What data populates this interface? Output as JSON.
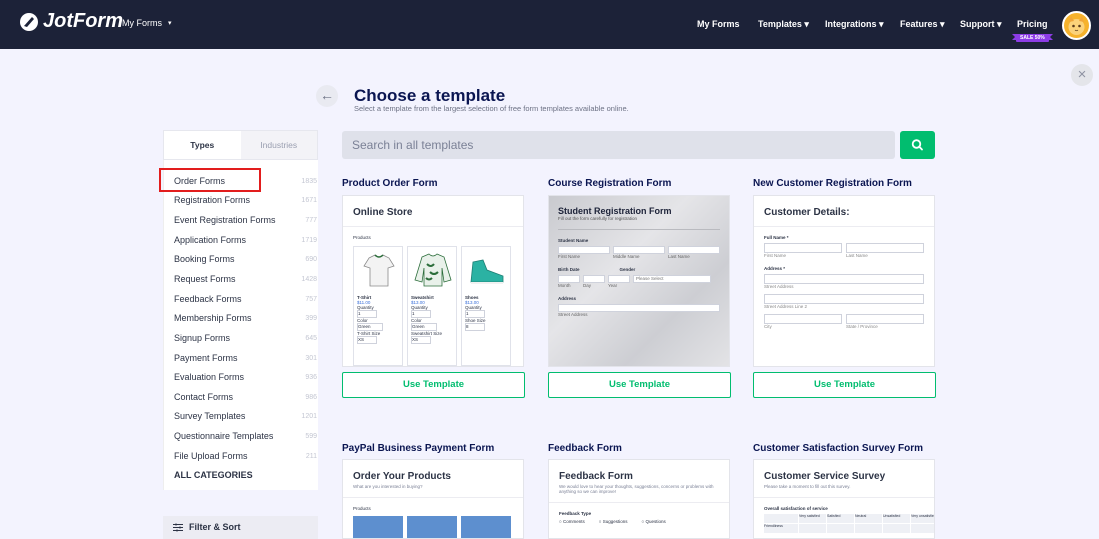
{
  "header": {
    "brand": "JotForm",
    "myforms_dropdown": "My Forms",
    "nav": [
      {
        "label": "My Forms"
      },
      {
        "label": "Templates ▾"
      },
      {
        "label": "Integrations ▾"
      },
      {
        "label": "Features ▾"
      },
      {
        "label": "Support ▾"
      },
      {
        "label": "Pricing"
      }
    ],
    "sale_badge": "SALE 50%"
  },
  "page": {
    "title": "Choose a template",
    "subtitle": "Select a template from the largest selection of free form templates available online."
  },
  "tabs": [
    {
      "label": "Types"
    },
    {
      "label": "Industries"
    }
  ],
  "categories": [
    {
      "label": "Order Forms",
      "count": "1835"
    },
    {
      "label": "Registration Forms",
      "count": "1671"
    },
    {
      "label": "Event Registration Forms",
      "count": "777"
    },
    {
      "label": "Application Forms",
      "count": "1719"
    },
    {
      "label": "Booking Forms",
      "count": "690"
    },
    {
      "label": "Request Forms",
      "count": "1428"
    },
    {
      "label": "Feedback Forms",
      "count": "757"
    },
    {
      "label": "Membership Forms",
      "count": "399"
    },
    {
      "label": "Signup Forms",
      "count": "645"
    },
    {
      "label": "Payment Forms",
      "count": "301"
    },
    {
      "label": "Evaluation Forms",
      "count": "936"
    },
    {
      "label": "Contact Forms",
      "count": "986"
    },
    {
      "label": "Survey Templates",
      "count": "1201"
    },
    {
      "label": "Questionnaire Templates",
      "count": "599"
    },
    {
      "label": "File Upload Forms",
      "count": "211"
    }
  ],
  "all_categories": "ALL CATEGORIES",
  "filter_sort": "Filter & Sort",
  "search": {
    "placeholder": "Search in all templates"
  },
  "use_template_label": "Use Template",
  "templates": [
    {
      "title": "Product Order Form",
      "preview": {
        "heading": "Online Store",
        "section": "Products",
        "products": [
          {
            "name": "T-Shirt",
            "price": "$11.00",
            "qty_label": "Quantity",
            "qty": "1",
            "color_label": "Color",
            "color": "Green",
            "size_label": "T-Shirt Size",
            "size": "XS"
          },
          {
            "name": "Sweatshirt",
            "price": "$13.00",
            "qty_label": "Quantity",
            "qty": "1",
            "color_label": "Color",
            "color": "Green",
            "size_label": "Sweatshirt Size",
            "size": "XS"
          },
          {
            "name": "Shoes",
            "price": "$13.00",
            "qty_label": "Quantity",
            "qty": "1",
            "size_label": "Shoe Size",
            "size": "8"
          }
        ]
      }
    },
    {
      "title": "Course Registration Form",
      "preview": {
        "heading": "Student Registration Form",
        "sub": "Fill out the form carefully for registration",
        "name_label": "Student Name",
        "name_parts": [
          "First Name",
          "Middle Name",
          "Last Name"
        ],
        "birth_label": "Birth Date",
        "birth_parts": [
          "Month",
          "Day",
          "Year"
        ],
        "gender_label": "Gender",
        "gender_placeholder": "Please Select",
        "address_label": "Address",
        "street_label": "Street Address"
      }
    },
    {
      "title": "New Customer Registration Form",
      "preview": {
        "heading": "Customer Details:",
        "fullname_label": "Full Name *",
        "name_parts": [
          "First Name",
          "Last Name"
        ],
        "address_label": "Address *",
        "street1": "Street Address",
        "street2": "Street Address Line 2",
        "city": "City",
        "state": "State / Province"
      }
    },
    {
      "title": "PayPal Business Payment Form",
      "preview": {
        "heading": "Order Your Products",
        "sub": "What are you interested in buying?",
        "section": "Products"
      }
    },
    {
      "title": "Feedback Form",
      "preview": {
        "heading": "Feedback Form",
        "sub": "We would love to hear your thoughts, suggestions, concerns or problems with anything so we can improve!",
        "type_label": "Feedback Type",
        "options": [
          "Comments",
          "Suggestions",
          "Questions"
        ]
      }
    },
    {
      "title": "Customer Satisfaction Survey Form",
      "preview": {
        "heading": "Customer Service Survey",
        "sub": "Please take a moment to fill out this survey.",
        "matrix_label": "Overall satisfaction of service",
        "columns": [
          "Very satisfied",
          "Satisfied",
          "Neutral",
          "Unsatisfied",
          "Very unsatisfied"
        ],
        "row": "Friendliness"
      }
    }
  ],
  "colors": {
    "navbar": "#1c2238",
    "accent_green": "#01bd6f",
    "highlight_red": "#e21d1d",
    "page_bg": "#f3f3fe",
    "sale_purple": "#8c3ce6"
  }
}
